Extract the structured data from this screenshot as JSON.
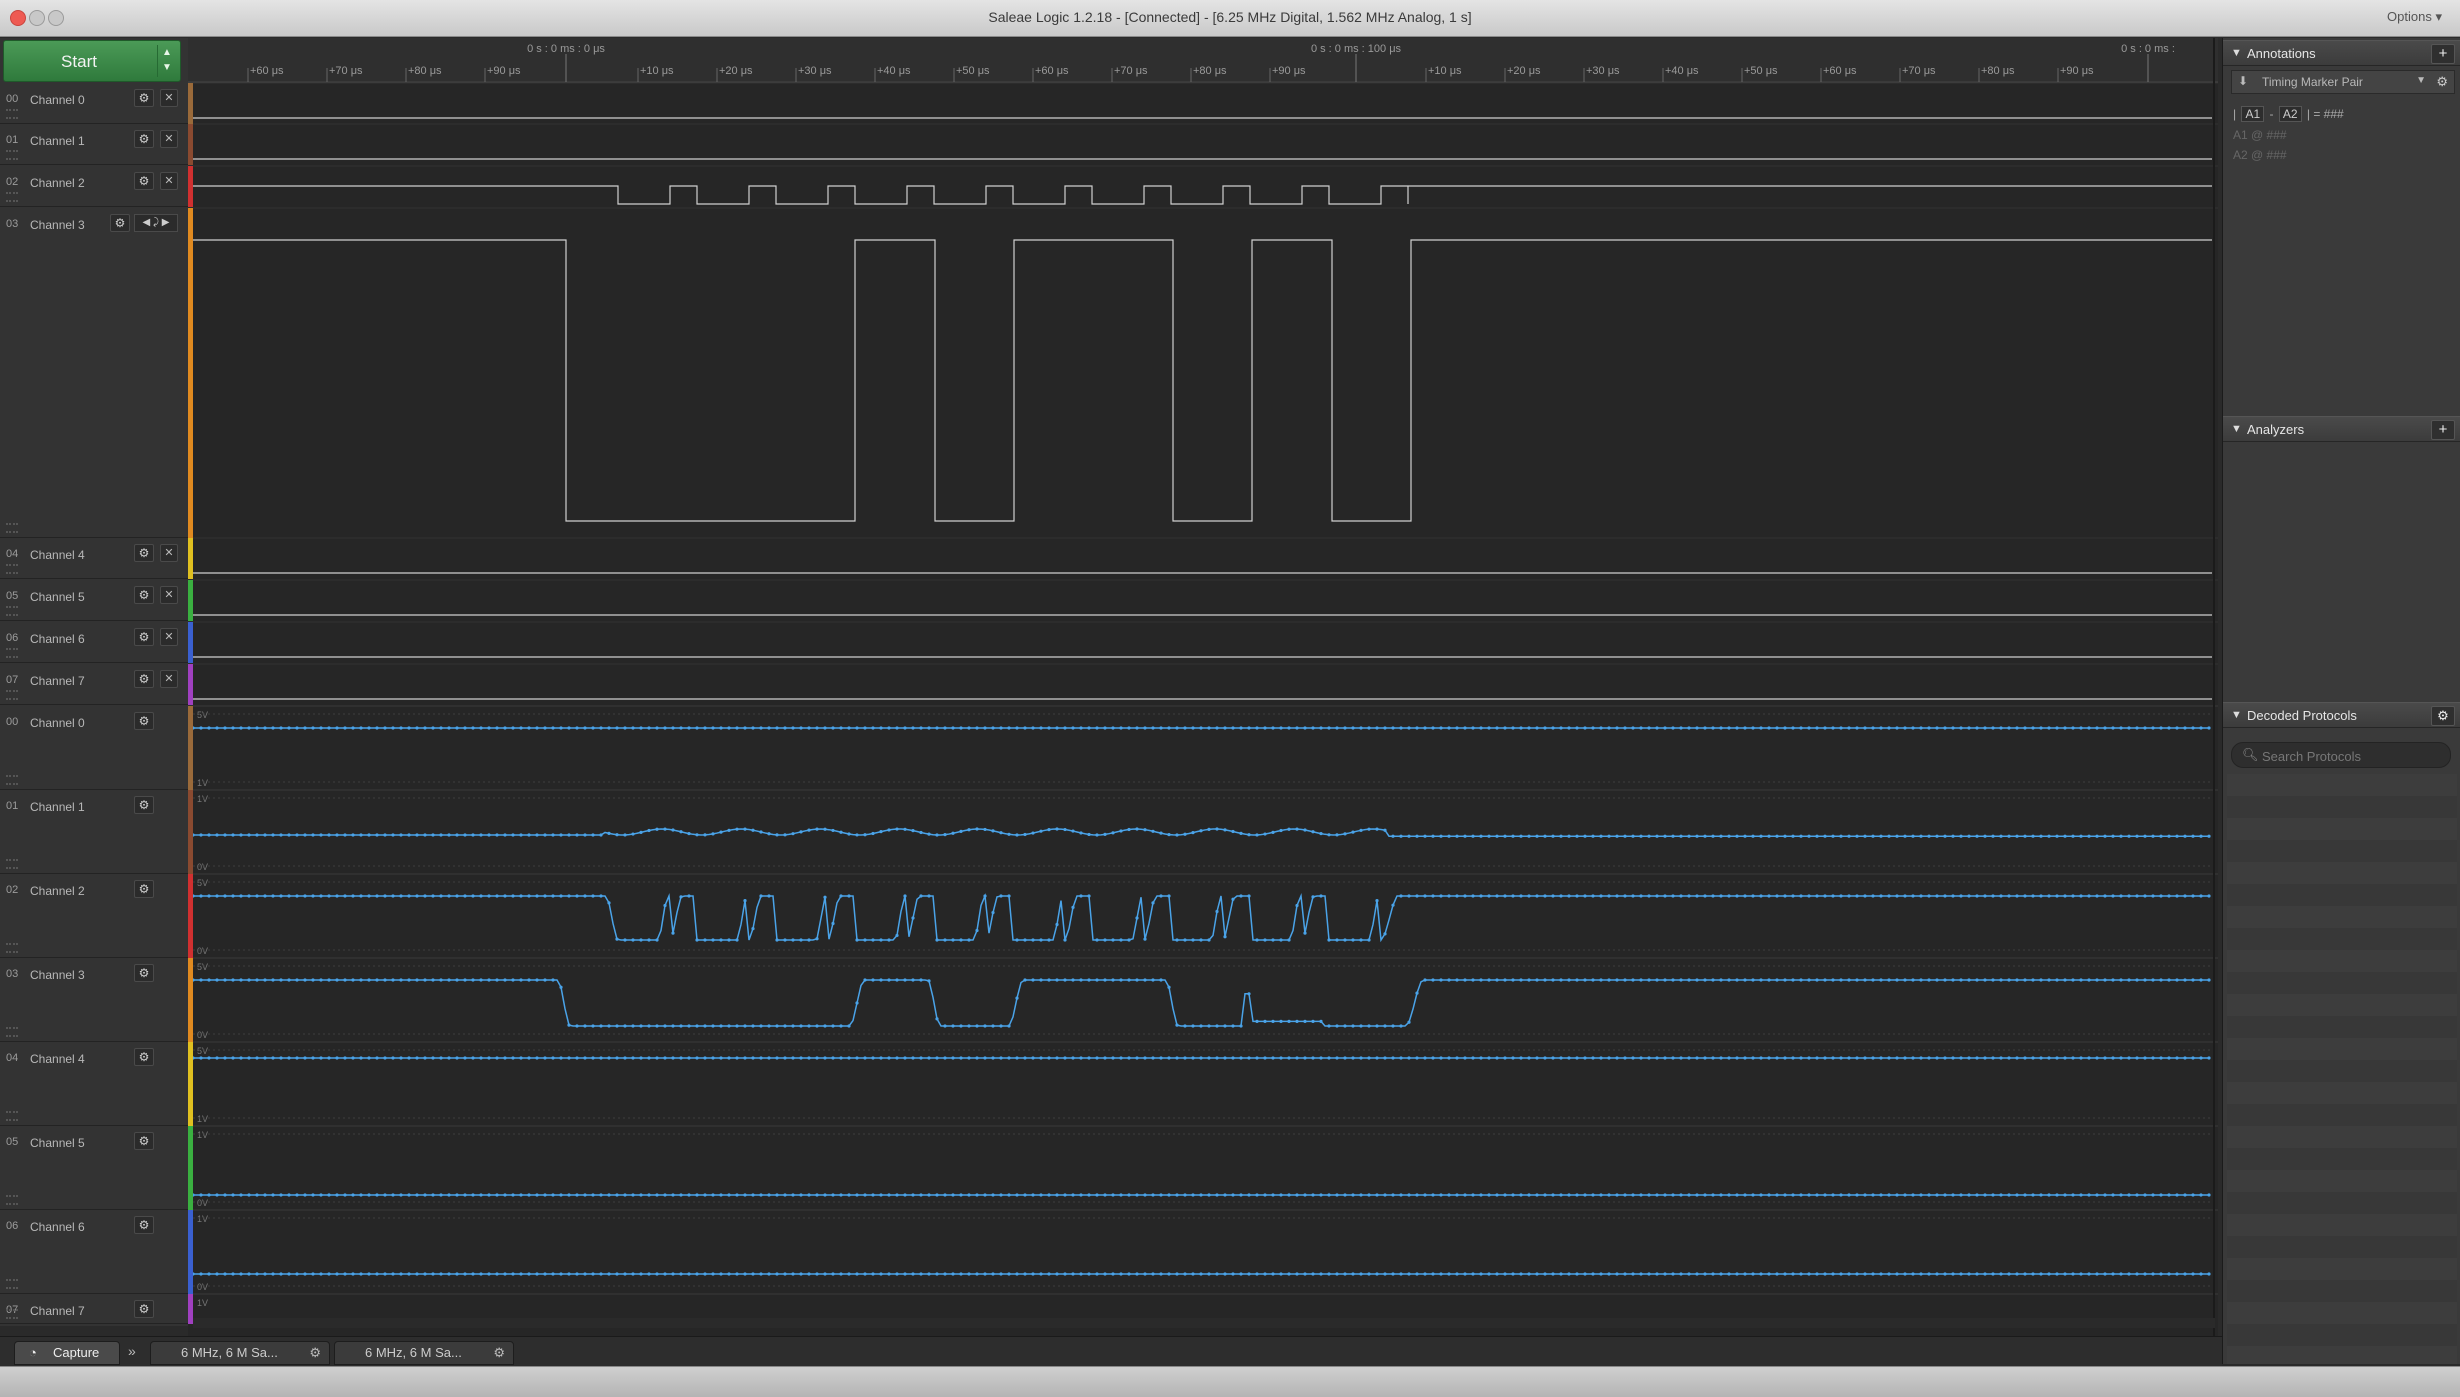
{
  "window": {
    "title": "Saleae Logic 1.2.18 - [Connected] - [6.25 MHz Digital, 1.562 MHz Analog, 1 s]",
    "options_label": "Options ▾"
  },
  "start_button": {
    "label": "Start",
    "arrows": "▲\n▼"
  },
  "timeline": {
    "markers": [
      "0 s : 0 ms : 0 μs",
      "0 s : 0 ms : 100 μs",
      "0 s : 0 ms :"
    ],
    "ticks_a": [
      "+60 μs",
      "+70 μs",
      "+80 μs",
      "+90 μs"
    ],
    "ticks_b": [
      "+10 μs",
      "+20 μs",
      "+30 μs",
      "+40 μs",
      "+50 μs",
      "+60 μs",
      "+70 μs",
      "+80 μs",
      "+90 μs"
    ],
    "ticks_c": [
      "+10 μs",
      "+20 μs",
      "+30 μs",
      "+40 μs",
      "+50 μs",
      "+60 μs",
      "+70 μs",
      "+80 μs",
      "+90 μs"
    ]
  },
  "digital_channels": [
    {
      "num": "00",
      "name": "Channel 0",
      "color": "#9a6a3a"
    },
    {
      "num": "01",
      "name": "Channel 1",
      "color": "#8a4a30"
    },
    {
      "num": "02",
      "name": "Channel 2",
      "color": "#d03030"
    },
    {
      "num": "03",
      "name": "Channel 3",
      "color": "#e08a20"
    },
    {
      "num": "04",
      "name": "Channel 4",
      "color": "#e0c020"
    },
    {
      "num": "05",
      "name": "Channel 5",
      "color": "#3ab040"
    },
    {
      "num": "06",
      "name": "Channel 6",
      "color": "#3a60d0"
    },
    {
      "num": "07",
      "name": "Channel 7",
      "color": "#a040c0"
    }
  ],
  "analog_channels": [
    {
      "num": "00",
      "name": "Channel 0",
      "color": "#9a6a3a"
    },
    {
      "num": "01",
      "name": "Channel 1",
      "color": "#8a4a30"
    },
    {
      "num": "02",
      "name": "Channel 2",
      "color": "#d03030"
    },
    {
      "num": "03",
      "name": "Channel 3",
      "color": "#e08a20"
    },
    {
      "num": "04",
      "name": "Channel 4",
      "color": "#e0c020"
    },
    {
      "num": "05",
      "name": "Channel 5",
      "color": "#3ab040"
    },
    {
      "num": "06",
      "name": "Channel 6",
      "color": "#3a60d0"
    },
    {
      "num": "07",
      "name": "Channel 7",
      "color": "#a040c0"
    }
  ],
  "analog_labels": {
    "top": "5V",
    "bottom": "0V",
    "one": "1V"
  },
  "icons": {
    "gear": "⚙",
    "close": "✕",
    "trigger": "◀ ⤸ ▶"
  },
  "right_panel": {
    "annotations_label": "Annotations",
    "marker_label": "Timing Marker Pair",
    "formula": {
      "a1": "A1",
      "a2": "A2",
      "dash": "-",
      "eq": "= ###"
    },
    "a1_line": "A1  @  ###",
    "a2_line": "A2  @  ###",
    "analyzers_label": "Analyzers",
    "decoded_label": "Decoded Protocols",
    "search_placeholder": "Search Protocols"
  },
  "bottom_tabs": {
    "capture": "Capture",
    "session1": "6 MHz, 6 M Sa...",
    "session2": "6 MHz, 6 M Sa...",
    "arrows": "»"
  },
  "waveform_colors": {
    "digital": "#cfcfcf",
    "analog": "#4aa3e8",
    "background": "#262626"
  }
}
